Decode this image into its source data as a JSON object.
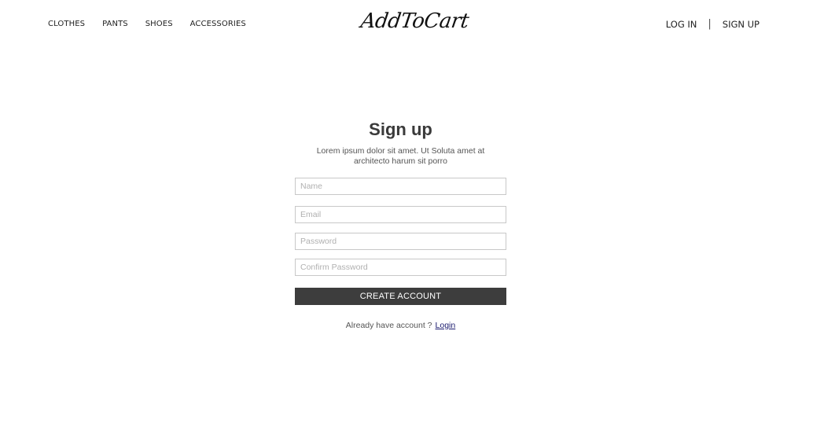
{
  "header": {
    "nav_left": [
      "CLOTHES",
      "PANTS",
      "SHOES",
      "ACCESSORIES"
    ],
    "logo": "AddToCart",
    "login_label": "LOG IN",
    "separator": "|",
    "signup_label": "SIGN UP"
  },
  "form": {
    "title": "Sign up",
    "subtitle": "Lorem ipsum dolor sit amet. Ut Soluta amet at architecto harum sit porro",
    "name_placeholder": "Name",
    "email_placeholder": "Email",
    "password_placeholder": "Password",
    "confirm_placeholder": "Confirm Password",
    "submit_label": "CREATE ACCOUNT",
    "already_text": "Already have account ?",
    "login_link": "Login"
  }
}
